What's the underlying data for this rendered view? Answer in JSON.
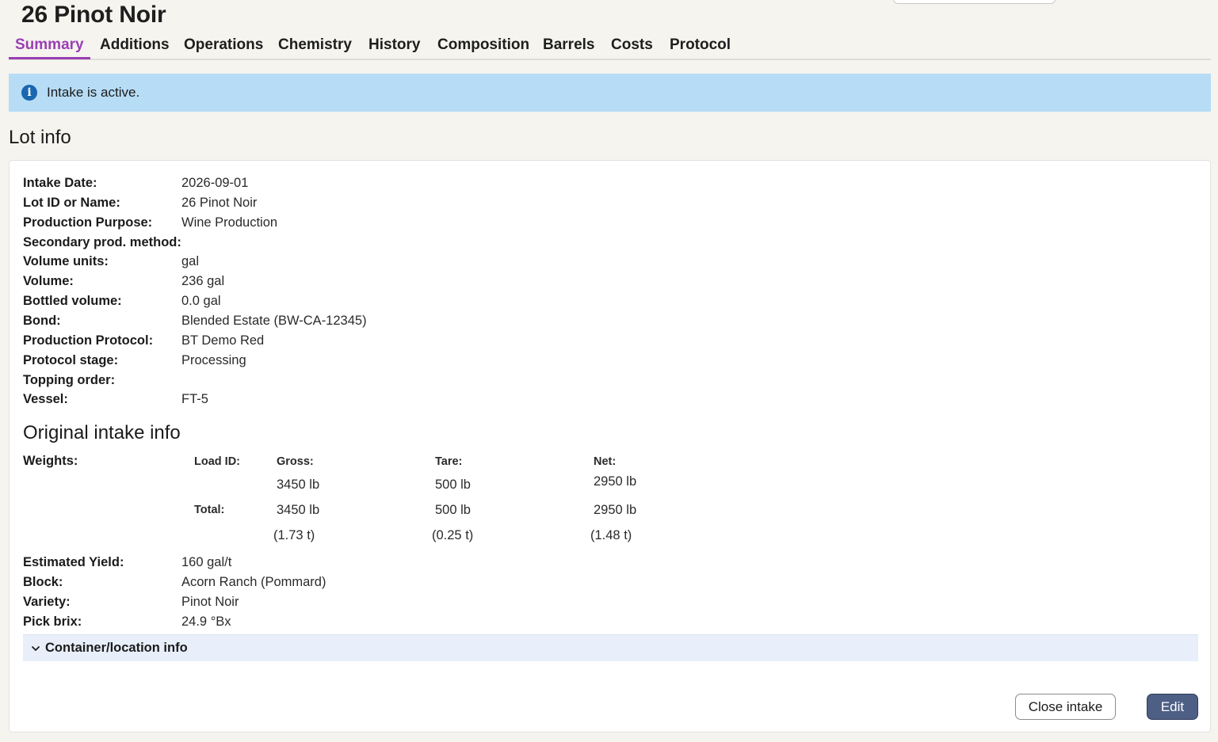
{
  "page": {
    "title": "26 Pinot Noir"
  },
  "tabs": [
    {
      "label": "Summary",
      "active": true
    },
    {
      "label": "Additions"
    },
    {
      "label": "Operations"
    },
    {
      "label": "Chemistry"
    },
    {
      "label": "History"
    },
    {
      "label": "Composition"
    },
    {
      "label": "Barrels"
    },
    {
      "label": "Costs"
    },
    {
      "label": "Protocol"
    }
  ],
  "alert": {
    "icon": "info-icon",
    "text": "Intake is active.",
    "color": "#b7dcf6"
  },
  "lot_info": {
    "title": "Lot info",
    "fields": [
      {
        "label": "Intake Date:",
        "value": "2026-09-01"
      },
      {
        "label": "Lot ID or Name:",
        "value": "26 Pinot Noir"
      },
      {
        "label": "Production Purpose:",
        "value": "Wine Production"
      },
      {
        "label": "Secondary prod. method:",
        "value": ""
      },
      {
        "label": "Volume units:",
        "value": "gal"
      },
      {
        "label": "Volume:",
        "value": "236 gal"
      },
      {
        "label": "Bottled volume:",
        "value": "0.0 gal"
      },
      {
        "label": "Bond:",
        "value": "Blended Estate (BW-CA-12345)"
      },
      {
        "label": "Production Protocol:",
        "value": "BT Demo Red"
      },
      {
        "label": "Protocol stage:",
        "value": "Processing"
      },
      {
        "label": "Topping order:",
        "value": ""
      },
      {
        "label": "Vessel:",
        "value": "FT-5"
      }
    ]
  },
  "intake": {
    "title": "Original intake info",
    "weights_label": "Weights:",
    "headers": {
      "load_id": "Load ID:",
      "gross": "Gross:",
      "tare": "Tare:",
      "net": "Net:"
    },
    "load_row": {
      "gross": "3450 lb",
      "tare": "500 lb",
      "net": "2950 lb"
    },
    "total_label": "Total:",
    "total_row": {
      "gross": "3450 lb",
      "tare": "500 lb",
      "net": "2950 lb"
    },
    "tons_row": {
      "gross": "(1.73 t)",
      "tare": "(0.25 t)",
      "net": "(1.48 t)"
    },
    "fields": [
      {
        "label": "Estimated Yield:",
        "value": "160 gal/t"
      },
      {
        "label": "Block:",
        "value": "Acorn Ranch (Pommard)"
      },
      {
        "label": "Variety:",
        "value": "Pinot Noir"
      },
      {
        "label": "Pick brix:",
        "value": "24.9 °Bx"
      }
    ]
  },
  "accordion": {
    "label": "Container/location info",
    "icon": "chevron-down-icon"
  },
  "actions": {
    "close_label": "Close intake",
    "edit_label": "Edit"
  },
  "colors": {
    "accent": "#9a3fb3",
    "primary_button": "#4e5f86",
    "info": "#1967ae"
  }
}
